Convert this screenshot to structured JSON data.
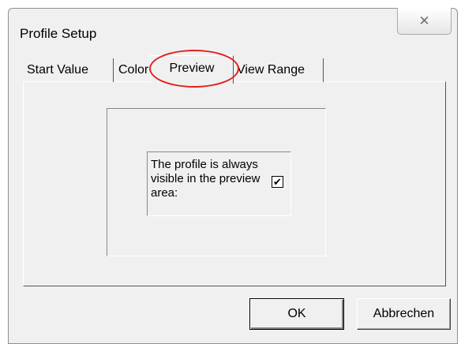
{
  "window": {
    "title": "Profile Setup",
    "close_glyph": "✕"
  },
  "tabs": [
    {
      "label": "Start Value",
      "active": false
    },
    {
      "label": "Color",
      "active": false
    },
    {
      "label": "Preview",
      "active": true
    },
    {
      "label": "View Range",
      "active": false
    }
  ],
  "preview_panel": {
    "description": "The profile is always visible in the preview area:",
    "checkbox_checked": true,
    "check_glyph": "✔"
  },
  "buttons": {
    "ok_label": "OK",
    "cancel_label": "Abbrechen"
  },
  "annotation": {
    "color": "#e02020"
  }
}
